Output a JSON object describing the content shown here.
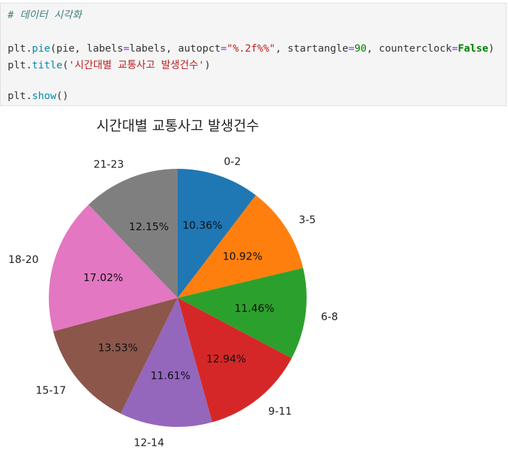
{
  "code": {
    "comment": "# 데이터 시각화",
    "line1": {
      "obj": "plt.",
      "fn": "pie",
      "args_a": "(pie, labels",
      "eq1": "=",
      "args_b": "labels, autopct",
      "eq2": "=",
      "fmt": "\"%.2f%%\"",
      "args_c": ", startangle",
      "eq3": "=",
      "angle": "90",
      "args_d": ", counterclock",
      "eq4": "=",
      "false_kw": "False",
      "close": ")"
    },
    "line2": {
      "obj": "plt.",
      "fn": "title",
      "open": "(",
      "title_str": "'시간대별 교통사고 발생건수'",
      "close": ")"
    },
    "line3": {
      "obj": "plt.",
      "fn": "show",
      "rest": "()"
    }
  },
  "chart_data": {
    "type": "pie",
    "title": "시간대별 교통사고 발생건수",
    "labels": [
      "0-2",
      "3-5",
      "6-8",
      "9-11",
      "12-14",
      "15-17",
      "18-20",
      "21-23"
    ],
    "values": [
      10.36,
      10.92,
      11.46,
      12.94,
      11.61,
      13.53,
      17.02,
      12.15
    ],
    "pct_labels": [
      "10.36%",
      "10.92%",
      "11.46%",
      "12.94%",
      "11.61%",
      "13.53%",
      "17.02%",
      "12.15%"
    ],
    "colors": [
      "#1f77b4",
      "#ff7f0e",
      "#2ca02c",
      "#d62728",
      "#9467bd",
      "#8c564b",
      "#e377c2",
      "#7f7f7f"
    ],
    "startangle": 90,
    "counterclock": false
  }
}
